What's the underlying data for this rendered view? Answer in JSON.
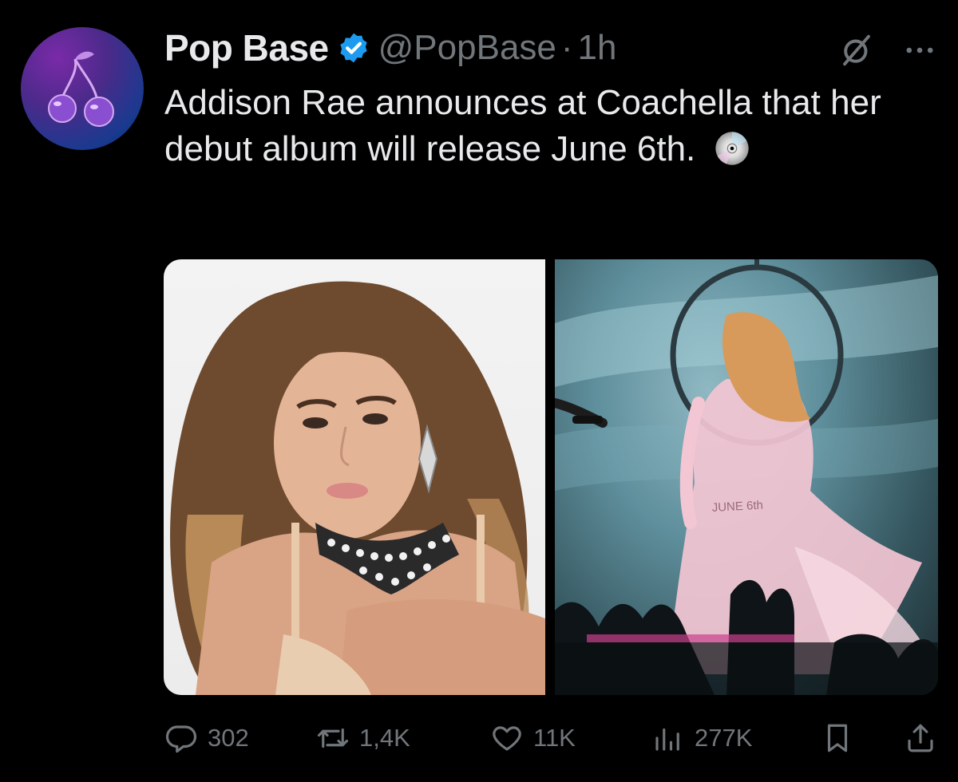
{
  "author": {
    "display_name": "Pop Base",
    "handle": "@PopBase",
    "separator": "·",
    "time": "1h",
    "verified_icon": "verified-badge-icon",
    "avatar_icon": "cherry-icon"
  },
  "tweet": {
    "text": "Addison Rae announces at Coachella that her debut album will release June 6th.",
    "emoji_icon": "optical-disc-icon"
  },
  "media": {
    "count": 2,
    "right_image_text": "JUNE 6th"
  },
  "actions": {
    "replies": "302",
    "reposts": "1,4K",
    "likes": "11K",
    "views": "277K"
  },
  "colors": {
    "background": "#000000",
    "text_primary": "#e7e9ea",
    "text_secondary": "#71767b",
    "verified_blue": "#1d9bf0"
  }
}
